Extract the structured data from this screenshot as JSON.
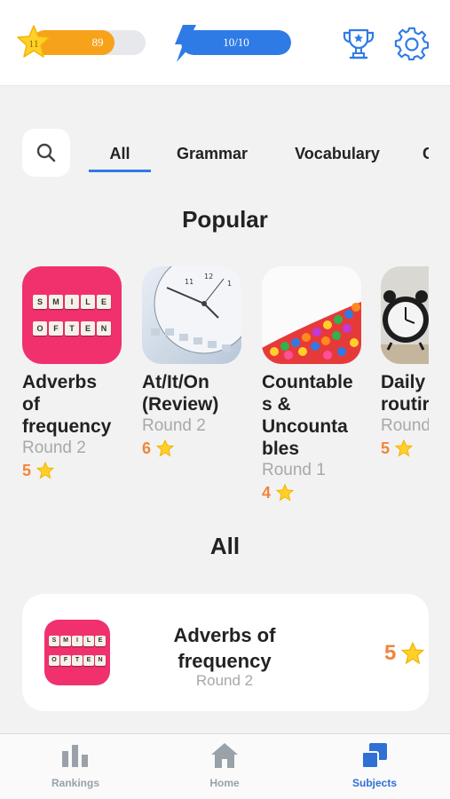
{
  "header": {
    "level": "11",
    "xp_value": "89",
    "xp_progress": 0.73,
    "energy_value": "10/10",
    "energy_progress": 1.0,
    "icons": [
      "star-icon",
      "bolt-icon",
      "trophy-icon",
      "gear-icon"
    ]
  },
  "tabs": [
    {
      "label": "All",
      "active": true
    },
    {
      "label": "Grammar",
      "active": false
    },
    {
      "label": "Vocabulary",
      "active": false
    },
    {
      "label": "C",
      "active": false
    }
  ],
  "popular": {
    "title": "Popular",
    "items": [
      {
        "title": "Adverbs of frequency",
        "title_lines": [
          "Adverbs",
          "of",
          "frequency"
        ],
        "round": "Round 2",
        "stars": "5"
      },
      {
        "title": "At/It/On (Review)",
        "title_lines": [
          "At/It/On",
          "(Review)"
        ],
        "round": "Round 2",
        "stars": "6"
      },
      {
        "title": "Countables & Uncountables",
        "title_lines": [
          "Countable",
          "s &",
          "Uncounta",
          "bles"
        ],
        "round": "Round 1",
        "stars": "4"
      },
      {
        "title": "Daily routine",
        "title_lines": [
          "Daily",
          "routir"
        ],
        "round": "Round",
        "stars": "5"
      }
    ]
  },
  "all": {
    "title": "All",
    "items": [
      {
        "title": "Adverbs of frequency",
        "round": "Round 2",
        "stars": "5"
      }
    ]
  },
  "thumb_text": {
    "line1": [
      "S",
      "M",
      "I",
      "L",
      "E"
    ],
    "line2": [
      "O",
      "F",
      "T",
      "E",
      "N"
    ]
  },
  "bottom_nav": [
    {
      "label": "Rankings",
      "active": false
    },
    {
      "label": "Home",
      "active": false
    },
    {
      "label": "Subjects",
      "active": true
    }
  ],
  "colors": {
    "accent": "#2f7be6",
    "xp": "#f7a21b",
    "stars": "#f0853a",
    "pink": "#f0316e"
  }
}
